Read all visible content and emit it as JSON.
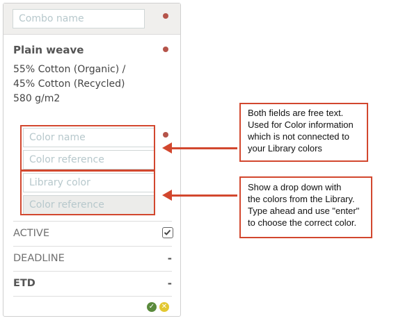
{
  "combo": {
    "name_placeholder": "Combo name"
  },
  "fabric": {
    "title": "Plain weave",
    "composition_line1": "55% Cotton (Organic) /",
    "composition_line2": "45% Cotton (Recycled)",
    "weight": "580 g/m2"
  },
  "color_fields": {
    "color_name_placeholder": "Color name",
    "color_reference_placeholder": "Color reference",
    "library_color_placeholder": "Library color",
    "library_reference_placeholder": "Color reference"
  },
  "rows": {
    "active_label": "ACTIVE",
    "deadline_label": "DEADLINE",
    "deadline_value": "-",
    "etd_label": "ETD",
    "etd_value": "-"
  },
  "annotations": {
    "note1": [
      "Both fields are free text.",
      "Used for Color information",
      "which is not connected to",
      "your Library colors"
    ],
    "note2": [
      "Show a drop down with",
      "the colors from the Library.",
      "Type ahead and use \"enter\"",
      "to choose the correct color."
    ]
  },
  "colors": {
    "accent_red": "#d2472e",
    "required_dot": "#b5544a",
    "confirm_green": "#5a8a3c",
    "cancel_yellow": "#e3c832"
  },
  "icons": {
    "checkbox": "check-icon",
    "confirm": "confirm-icon",
    "cancel": "cancel-icon"
  }
}
